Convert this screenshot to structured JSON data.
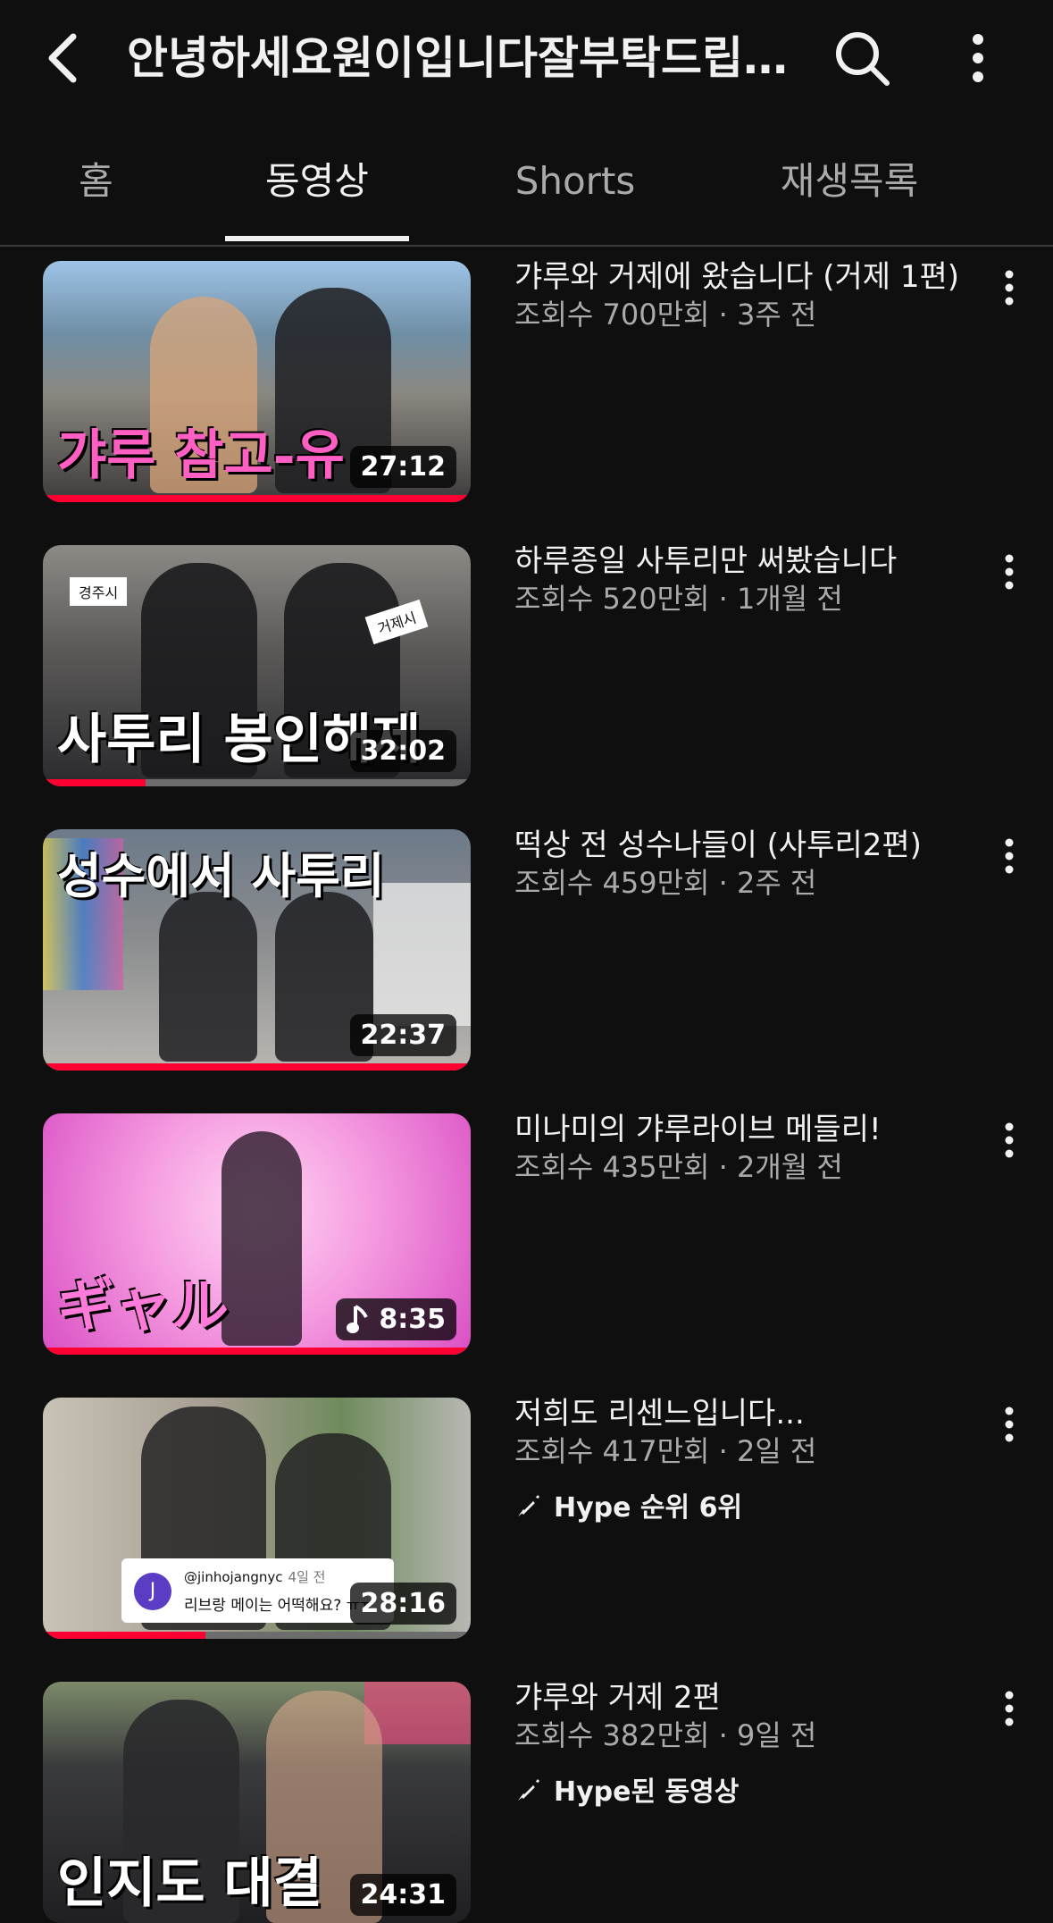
{
  "header": {
    "title": "안녕하세요원이입니다잘부탁드립니다",
    "back_icon": "back-arrow-icon",
    "search_icon": "search-icon",
    "more_icon": "more-vertical-icon"
  },
  "tabs": [
    {
      "label": "홈",
      "active": false
    },
    {
      "label": "동영상",
      "active": true
    },
    {
      "label": "Shorts",
      "active": false
    },
    {
      "label": "재생목록",
      "active": false
    }
  ],
  "colors": {
    "background": "#0f0f0f",
    "progress": "#ff0033",
    "secondary_text": "#aaaaaa"
  },
  "videos": [
    {
      "title": "갸루와 거제에 왔습니다 (거제 1편)",
      "stats": "조회수 700만회 · 3주 전",
      "duration": "27:12",
      "thumb_caption": "갸루 참고-유",
      "watched_fraction": 1.0
    },
    {
      "title": "하루종일 사투리만 써봤습니다",
      "stats": "조회수 520만회 · 1개월 전",
      "duration": "32:02",
      "thumb_caption": "사투리 봉인해제",
      "thumb_signs": [
        "경주시",
        "거제시"
      ],
      "watched_fraction": 0.24
    },
    {
      "title": "떡상 전 성수나들이 (사투리2편)",
      "stats": "조회수 459만회 · 2주 전",
      "duration": "22:37",
      "thumb_caption": "성수에서 사투리",
      "watched_fraction": 1.0
    },
    {
      "title": "미나미의 갸루라이브 메들리!",
      "stats": "조회수 435만회 · 2개월 전",
      "duration": "8:35",
      "duration_icon": "music-note-icon",
      "thumb_caption": "ギャル",
      "watched_fraction": 1.0
    },
    {
      "title": "저희도 리센느입니다...",
      "stats": "조회수 417만회 · 2일 전",
      "duration": "28:16",
      "hype": "Hype 순위 6위",
      "hype_icon": "hype-rocket-icon",
      "comment": {
        "avatar_letter": "J",
        "user": "@jinhojangnyc",
        "time": "4일 전",
        "text": "리브랑 메이는 어떡해요? ㅠㅠ"
      },
      "watched_fraction": 0.38
    },
    {
      "title": "갸루와 거제 2편",
      "stats": "조회수 382만회 · 9일 전",
      "duration": "24:31",
      "hype": "Hype된 동영상",
      "hype_icon": "hype-rocket-icon",
      "thumb_caption": "인지도 대결",
      "watched_fraction": 0.0
    }
  ]
}
